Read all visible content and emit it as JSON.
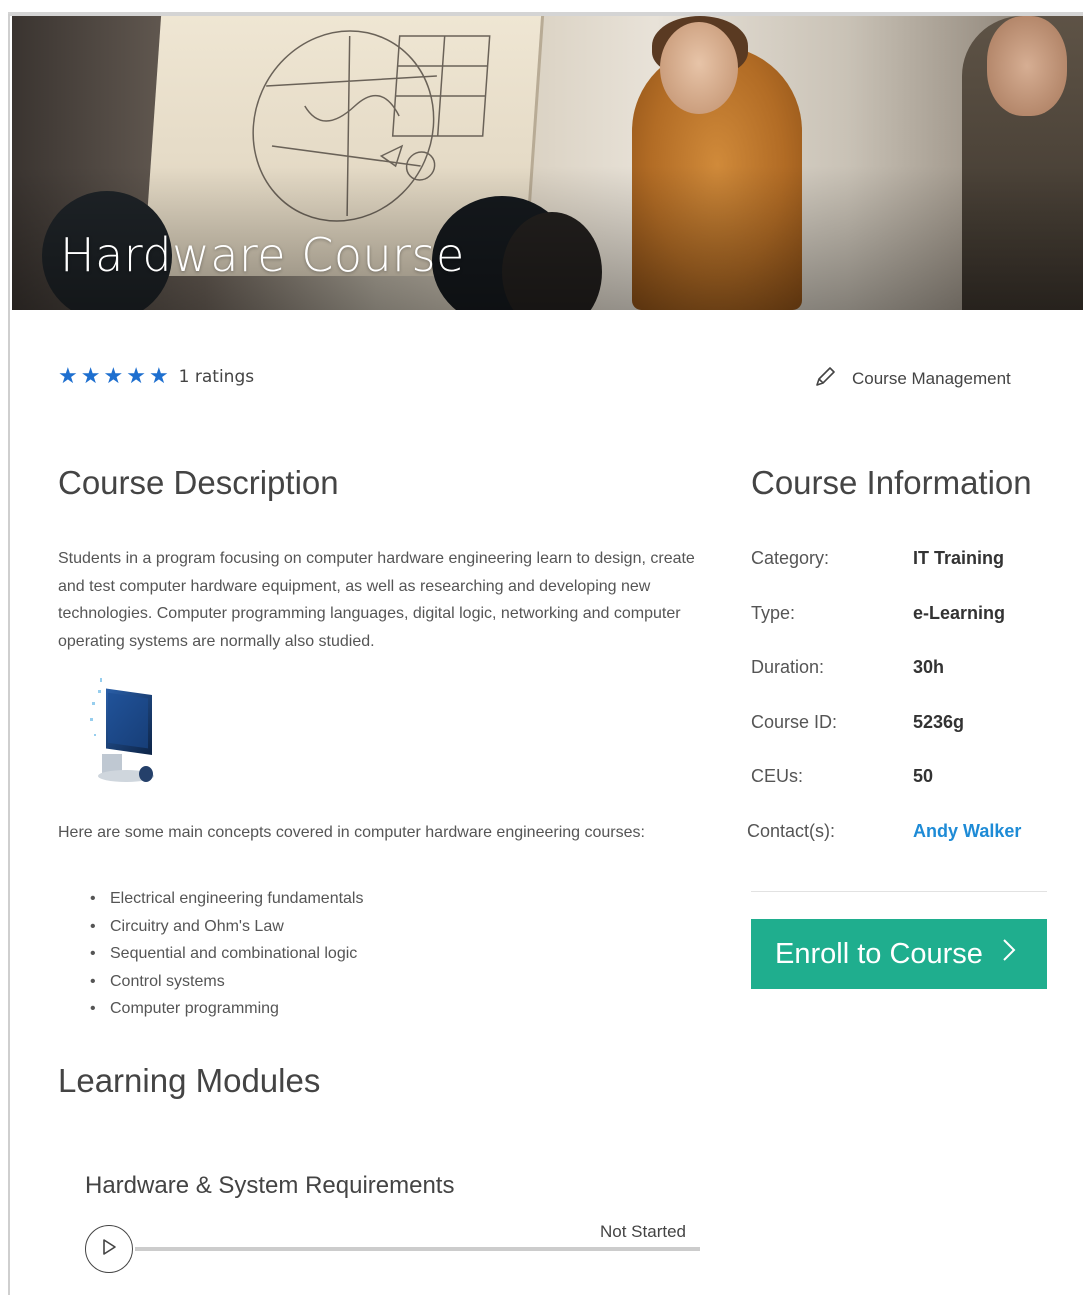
{
  "hero": {
    "title": "Hardware Course"
  },
  "rating": {
    "stars": 5,
    "count_label": "1 ratings"
  },
  "course_management": {
    "label": "Course Management"
  },
  "description": {
    "title": "Course Description",
    "text": "Students in a program focusing on computer hardware engineering learn to design, create and test computer hardware equipment, as well as researching and developing new technologies. Computer programming languages, digital logic, networking and computer operating systems are normally also studied.",
    "concepts_intro": "Here are some main concepts covered in computer hardware engineering courses:",
    "concepts": [
      "Electrical engineering fundamentals",
      "Circuitry and Ohm's Law",
      "Sequential and combinational logic",
      "Control systems",
      "Computer programming"
    ]
  },
  "info": {
    "title": "Course Information",
    "rows": [
      {
        "label": "Category:",
        "value": "IT Training"
      },
      {
        "label": "Type:",
        "value": "e-Learning"
      },
      {
        "label": "Duration:",
        "value": "30h"
      },
      {
        "label": "Course ID:",
        "value": "5236g"
      },
      {
        "label": "CEUs:",
        "value": "50"
      },
      {
        "label": "Contact(s):",
        "value": "Andy Walker"
      }
    ]
  },
  "enroll": {
    "label": "Enroll to Course"
  },
  "modules": {
    "title": "Learning Modules",
    "items": [
      {
        "name": "Hardware & System Requirements",
        "status": "Not Started"
      }
    ]
  },
  "colors": {
    "star": "#1e6fcf",
    "enroll_button": "#1fae8e",
    "link": "#1e8bd6"
  },
  "icons": [
    "star-icon",
    "pencil-icon",
    "chevron-right-icon",
    "play-icon"
  ]
}
